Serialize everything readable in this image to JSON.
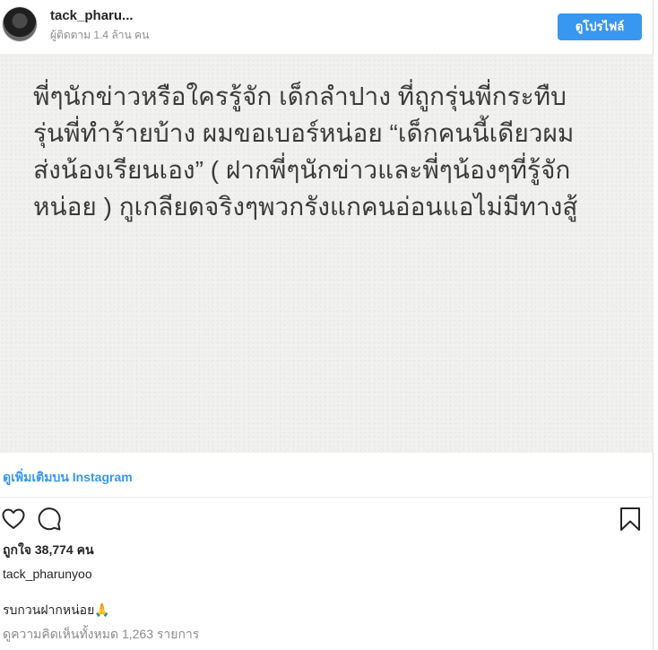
{
  "header": {
    "username": "tack_pharu...",
    "followers": "ผู้ติดตาม 1.4 ล้าน คน",
    "profile_button": "ดูโปรไฟล์"
  },
  "post": {
    "text": "พี่ๆนักข่าวหรือใครรู้จัก เด็กลำปาง ที่ถูกรุ่นพี่กระทืบ\nรุ่นพี่ทำร้ายบ้าง ผมขอเบอร์หน่อย “เด็กคนนี้เดียวผม\nส่งน้องเรียนเอง” ( ฝากพี่ๆนักข่าวและพี่ๆน้องๆที่รู้จัก\nหน่อย ) กูเกลียดจริงๆพวกรังแกคนอ่อนแอไม่มีทางสู้"
  },
  "view_more": "ดูเพิ่มเติมบน Instagram",
  "actions": {
    "icons": [
      "heart-icon",
      "comment-icon",
      "bookmark-icon"
    ]
  },
  "likes": "ถูกใจ 38,774 คน",
  "caption": {
    "username": "tack_pharunyoo",
    "text": "รบกวนฝากหน่อย🙏"
  },
  "comments": "ดูความคิดเห็นทั้งหมด 1,263 รายการ",
  "colors": {
    "accent": "#3897f0",
    "text": "#262626",
    "muted": "#8e8e8e",
    "image_bg": "#f1f1ef"
  }
}
